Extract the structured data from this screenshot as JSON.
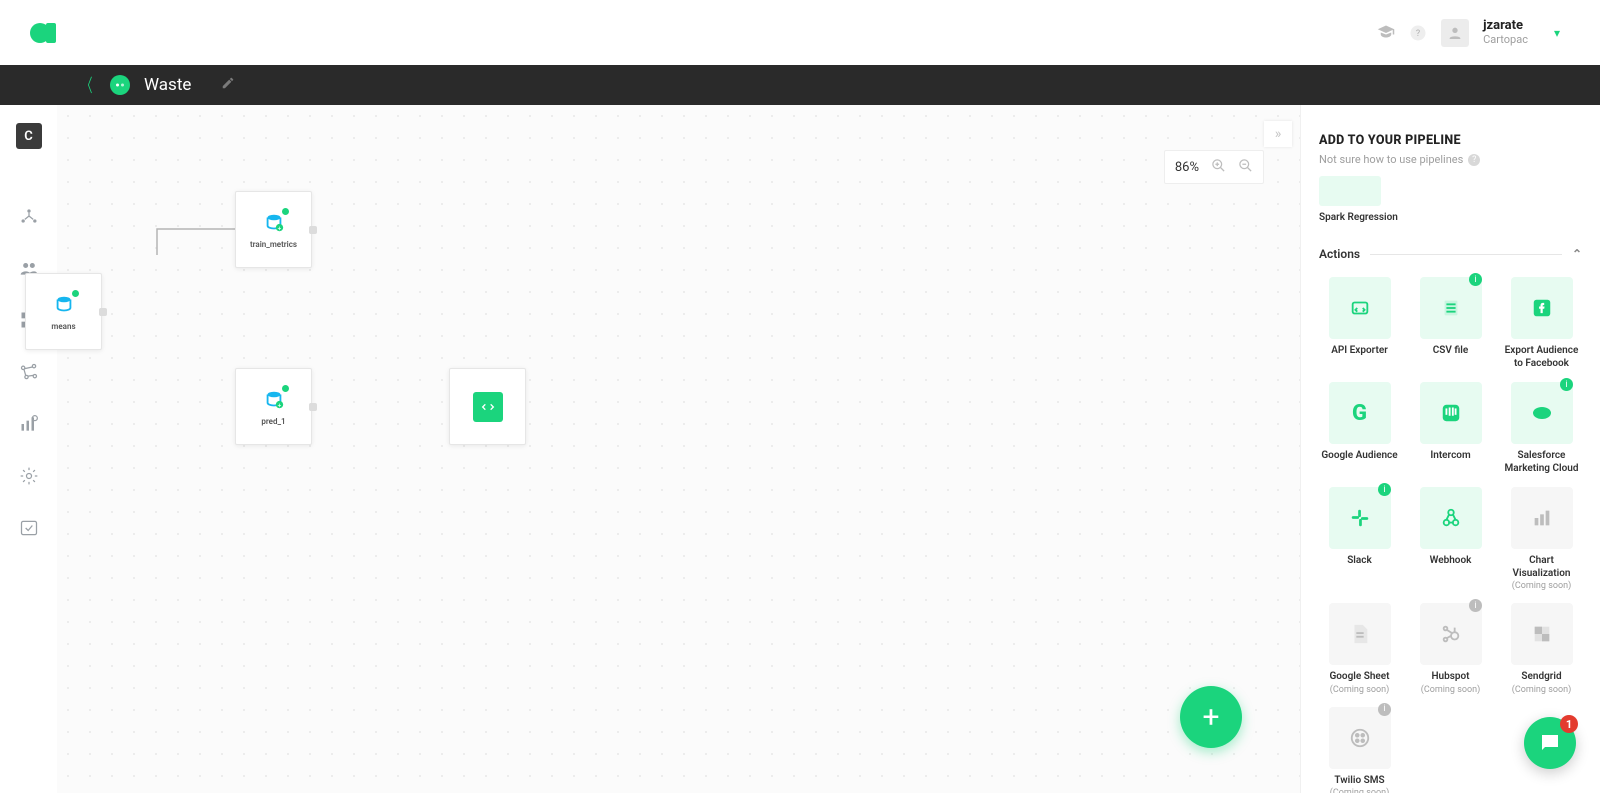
{
  "user": {
    "name": "jzarate",
    "org": "Cartopac"
  },
  "titlebar": {
    "project_name": "Waste"
  },
  "leftnav": {
    "initial": "C"
  },
  "zoom": {
    "percent": "86%"
  },
  "nodes": {
    "means": "means",
    "train_metrics": "train_metrics",
    "pred_1": "pred_1",
    "code": ""
  },
  "fab": {
    "plus": "+"
  },
  "panel": {
    "title": "ADD TO YOUR PIPELINE",
    "help": "Not sure how to use pipelines",
    "spark": "Spark Regression",
    "actions_heading": "Actions",
    "coming_soon": "(Coming soon)",
    "tiles": [
      {
        "label": "API Exporter",
        "icon": "api",
        "state": "active",
        "info": false
      },
      {
        "label": "CSV file",
        "icon": "csv",
        "state": "active",
        "info": true
      },
      {
        "label": "Export Audience to Facebook",
        "icon": "facebook",
        "state": "active",
        "info": false
      },
      {
        "label": "Google Audience",
        "icon": "google",
        "state": "active",
        "info": false
      },
      {
        "label": "Intercom",
        "icon": "intercom",
        "state": "active",
        "info": false
      },
      {
        "label": "Salesforce Marketing Cloud",
        "icon": "salesforce",
        "state": "active",
        "info": true
      },
      {
        "label": "Slack",
        "icon": "slack",
        "state": "active",
        "info": true
      },
      {
        "label": "Webhook",
        "icon": "webhook",
        "state": "active",
        "info": false
      },
      {
        "label": "Chart Visualization",
        "icon": "chart",
        "state": "disabled",
        "info": false,
        "sub": true
      },
      {
        "label": "Google Sheet",
        "icon": "sheet",
        "state": "disabled",
        "info": false,
        "sub": true
      },
      {
        "label": "Hubspot",
        "icon": "hubspot",
        "state": "disabled",
        "info": true,
        "sub": true
      },
      {
        "label": "Sendgrid",
        "icon": "sendgrid",
        "state": "disabled",
        "info": false,
        "sub": true
      },
      {
        "label": "Twilio SMS",
        "icon": "twilio",
        "state": "disabled",
        "info": true,
        "sub": true
      }
    ]
  },
  "chat": {
    "count": "1"
  }
}
